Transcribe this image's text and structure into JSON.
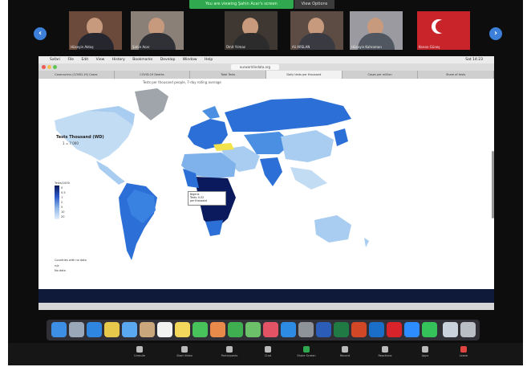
{
  "banner": {
    "share_text": "You are viewing Şahin Acar's screen",
    "view_options": "View Options"
  },
  "participants": [
    {
      "name": "Hüseyin Aktaş",
      "bg": "#6b4a3c",
      "body": "#26262e"
    },
    {
      "name": "Şahin Acar",
      "bg": "#8a8077",
      "body": "#2f3136"
    },
    {
      "name": "Ümit Yılmaz",
      "bg": "#3f3832",
      "body": "#2c2c2c"
    },
    {
      "name": "Ali ARSLAN",
      "bg": "#5c4c44",
      "body": "#3a3a42"
    },
    {
      "name": "Hüseyin Kahraman",
      "bg": "#9a9aa0",
      "body": "#515760"
    },
    {
      "name": "Kenan Güneş",
      "bg": "#c8242a",
      "body": "#d8d8d8"
    }
  ],
  "menubar": {
    "items": [
      "Safari",
      "File",
      "Edit",
      "View",
      "History",
      "Bookmarks",
      "Develop",
      "Window",
      "Help"
    ],
    "right": "Sat 14:23"
  },
  "browser": {
    "url": "ourworldindata.org"
  },
  "tabs": [
    "Coronavirus (COVID-19) Cases",
    "COVID-19 Deaths",
    "Total Tests",
    "Daily tests per thousand",
    "Cases per million",
    "Share of tests"
  ],
  "active_tab": 3,
  "map": {
    "caption": "Tests per thousand people, 7-day rolling average",
    "title": "Tests Thousand (WD)",
    "subtitle": "1 = 7 000",
    "legend_title": "Tests/1000",
    "legend_labels": [
      "0",
      "0.5",
      "1",
      "2",
      "5",
      "10",
      "20"
    ],
    "nodata_title": "Countries with no data",
    "nodata_lines": [
      "n/a",
      "No data"
    ],
    "tooltip_lines": [
      "Nigeria",
      "Tests: 0.02",
      "per thousand"
    ]
  },
  "colors": {
    "accent_blue": "#3b7fd9",
    "share_green": "#2fa84f",
    "map_dark": "#0a1a5c",
    "map_mid": "#2c6fd6",
    "map_light": "#a9cdf0"
  },
  "toolbar": [
    "Unmute",
    "Start Video",
    "Participants",
    "Chat",
    "Share Screen",
    "Record",
    "Reactions",
    "Apps",
    "Leave"
  ],
  "icons": {
    "prev": "chevron-left-icon",
    "next": "chevron-right-icon"
  }
}
